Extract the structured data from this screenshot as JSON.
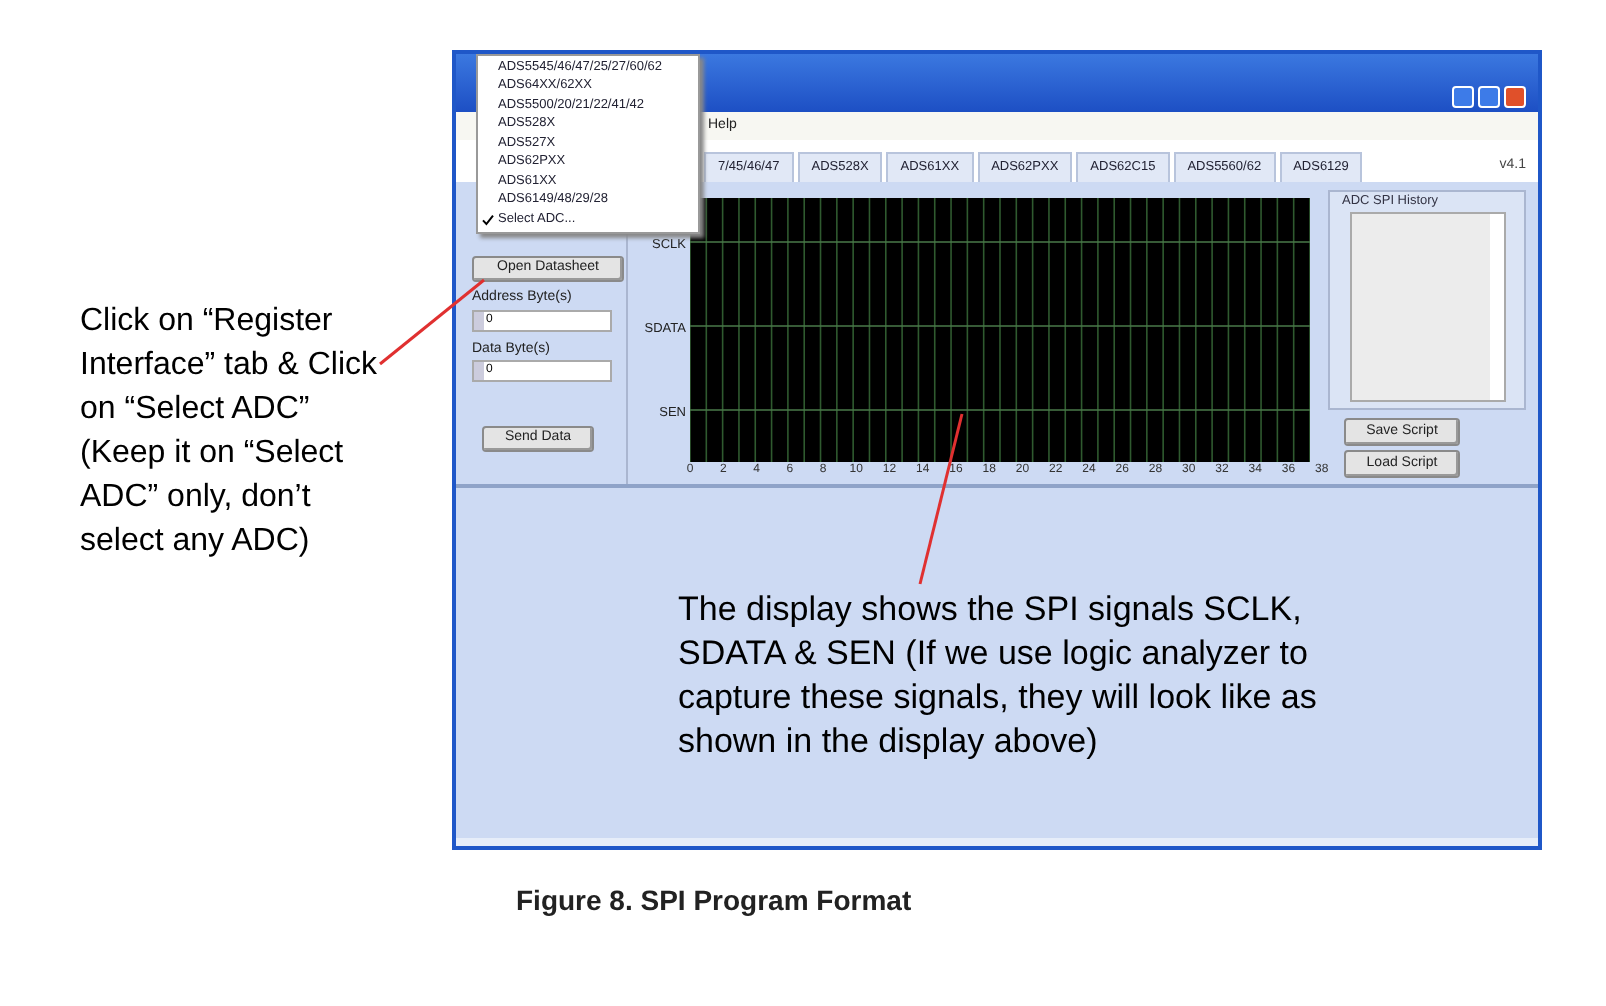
{
  "annotation": "Click on “Register Interface” tab & Click on “Select ADC” (Keep it on “Select ADC” only, don’t select any ADC)",
  "window": {
    "menu": [
      "Help"
    ],
    "dropdown": [
      {
        "label": "ADS5545/46/47/25/27/60/62",
        "checked": false
      },
      {
        "label": "ADS64XX/62XX",
        "checked": false
      },
      {
        "label": "ADS5500/20/21/22/41/42",
        "checked": false
      },
      {
        "label": "ADS528X",
        "checked": false
      },
      {
        "label": "ADS527X",
        "checked": false
      },
      {
        "label": "ADS62PXX",
        "checked": false
      },
      {
        "label": "ADS61XX",
        "checked": false
      },
      {
        "label": "ADS6149/48/29/28",
        "checked": false
      },
      {
        "label": "Select ADC...",
        "checked": true
      }
    ],
    "tabs": [
      {
        "label": "7/45/46/47",
        "selected": false
      },
      {
        "label": "ADS528X",
        "selected": false
      },
      {
        "label": "ADS61XX",
        "selected": false
      },
      {
        "label": "ADS62PXX",
        "selected": false
      },
      {
        "label": "ADS62C15",
        "selected": false
      },
      {
        "label": "ADS5560/62",
        "selected": false
      },
      {
        "label": "ADS6129",
        "selected": false
      }
    ],
    "version": "v4.1",
    "left_panel": {
      "open_button": "Open Datasheet",
      "address_label": "Address Byte(s)",
      "address_value": "0",
      "data_label": "Data Byte(s)",
      "data_value": "0",
      "send_button": "Send Data"
    },
    "display": {
      "signals": [
        "SCLK",
        "SDATA",
        "SEN"
      ],
      "x_ticks": [
        "0",
        "2",
        "4",
        "6",
        "8",
        "10",
        "12",
        "14",
        "16",
        "18",
        "20",
        "22",
        "24",
        "26",
        "28",
        "30",
        "32",
        "34",
        "36",
        "38"
      ]
    },
    "history": {
      "title": "ADC SPI History",
      "save_button": "Save Script",
      "load_button": "Load Script"
    },
    "note": "The display shows the SPI signals SCLK, SDATA & SEN (If we use logic analyzer to capture these signals, they will look like as shown in the display above)"
  },
  "caption": "Figure 8. SPI Program Format"
}
